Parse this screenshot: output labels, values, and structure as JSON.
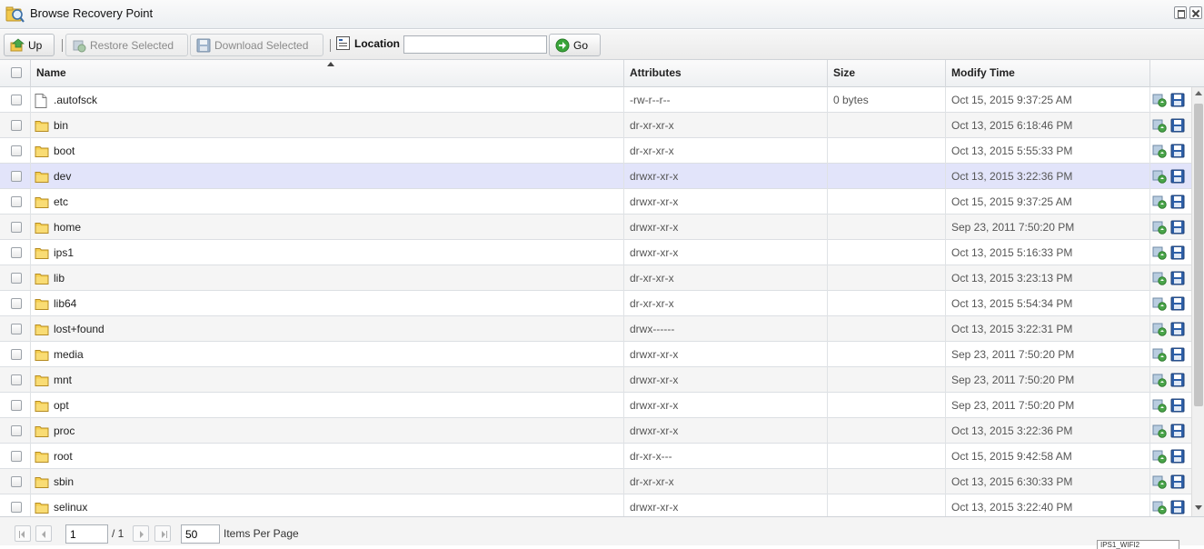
{
  "window": {
    "title": "Browse Recovery Point"
  },
  "toolbar": {
    "up_label": "Up",
    "restore_label": "Restore Selected",
    "download_label": "Download Selected",
    "location_label": "Location",
    "location_value": "",
    "go_label": "Go"
  },
  "columns": {
    "name": "Name",
    "attributes": "Attributes",
    "size": "Size",
    "modify_time": "Modify Time"
  },
  "rows": [
    {
      "name": ".autofsck",
      "type": "file",
      "attributes": "-rw-r--r--",
      "size": "0 bytes",
      "modified": "Oct 15, 2015 9:37:25 AM"
    },
    {
      "name": "bin",
      "type": "folder",
      "attributes": "dr-xr-xr-x",
      "size": "",
      "modified": "Oct 13, 2015 6:18:46 PM"
    },
    {
      "name": "boot",
      "type": "folder",
      "attributes": "dr-xr-xr-x",
      "size": "",
      "modified": "Oct 13, 2015 5:55:33 PM"
    },
    {
      "name": "dev",
      "type": "folder",
      "attributes": "drwxr-xr-x",
      "size": "",
      "modified": "Oct 13, 2015 3:22:36 PM",
      "selected": true
    },
    {
      "name": "etc",
      "type": "folder",
      "attributes": "drwxr-xr-x",
      "size": "",
      "modified": "Oct 15, 2015 9:37:25 AM"
    },
    {
      "name": "home",
      "type": "folder",
      "attributes": "drwxr-xr-x",
      "size": "",
      "modified": "Sep 23, 2011 7:50:20 PM"
    },
    {
      "name": "ips1",
      "type": "folder",
      "attributes": "drwxr-xr-x",
      "size": "",
      "modified": "Oct 13, 2015 5:16:33 PM"
    },
    {
      "name": "lib",
      "type": "folder",
      "attributes": "dr-xr-xr-x",
      "size": "",
      "modified": "Oct 13, 2015 3:23:13 PM"
    },
    {
      "name": "lib64",
      "type": "folder",
      "attributes": "dr-xr-xr-x",
      "size": "",
      "modified": "Oct 13, 2015 5:54:34 PM"
    },
    {
      "name": "lost+found",
      "type": "folder",
      "attributes": "drwx------",
      "size": "",
      "modified": "Oct 13, 2015 3:22:31 PM"
    },
    {
      "name": "media",
      "type": "folder",
      "attributes": "drwxr-xr-x",
      "size": "",
      "modified": "Sep 23, 2011 7:50:20 PM"
    },
    {
      "name": "mnt",
      "type": "folder",
      "attributes": "drwxr-xr-x",
      "size": "",
      "modified": "Sep 23, 2011 7:50:20 PM"
    },
    {
      "name": "opt",
      "type": "folder",
      "attributes": "drwxr-xr-x",
      "size": "",
      "modified": "Sep 23, 2011 7:50:20 PM"
    },
    {
      "name": "proc",
      "type": "folder",
      "attributes": "drwxr-xr-x",
      "size": "",
      "modified": "Oct 13, 2015 3:22:36 PM"
    },
    {
      "name": "root",
      "type": "folder",
      "attributes": "dr-xr-x---",
      "size": "",
      "modified": "Oct 15, 2015 9:42:58 AM"
    },
    {
      "name": "sbin",
      "type": "folder",
      "attributes": "dr-xr-xr-x",
      "size": "",
      "modified": "Oct 13, 2015 6:30:33 PM"
    },
    {
      "name": "selinux",
      "type": "folder",
      "attributes": "drwxr-xr-x",
      "size": "",
      "modified": "Oct 13, 2015 3:22:40 PM"
    }
  ],
  "pager": {
    "page": "1",
    "total_pages": "/ 1",
    "per_page": "50",
    "per_page_label": "Items Per Page"
  },
  "status_text": "IPS1_WIFI2",
  "icons": {
    "app": "search-folder-icon",
    "up": "folder-up-icon",
    "restore": "restore-icon",
    "download": "floppy-disk-icon",
    "location": "location-icon",
    "go": "arrow-right-icon",
    "file": "document-icon",
    "folder": "folder-icon"
  },
  "colors": {
    "selected_row": "#e2e4fa",
    "alt_row": "#f5f5f5",
    "go_green": "#3aa53a",
    "save_blue": "#2d5fa8"
  }
}
